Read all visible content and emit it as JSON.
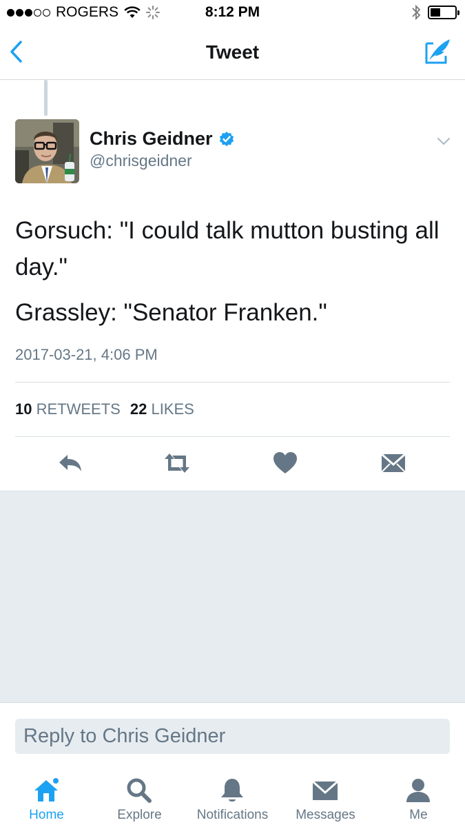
{
  "status_bar": {
    "carrier": "ROGERS",
    "time": "8:12 PM",
    "signal_bars_filled": 3,
    "signal_bars_total": 5,
    "battery_level": 0.4
  },
  "nav": {
    "title": "Tweet",
    "back_icon": "chevron-left-icon",
    "compose_icon": "compose-quill-icon"
  },
  "tweet": {
    "author_name": "Chris Geidner",
    "author_handle": "@chrisgeidner",
    "verified": true,
    "paragraphs": [
      "Gorsuch: \"I could talk mutton busting all day.\"",
      "Grassley: \"Senator Franken.\""
    ],
    "timestamp": "2017-03-21, 4:06 PM",
    "retweets_count": "10",
    "retweets_label": "RETWEETS",
    "likes_count": "22",
    "likes_label": "LIKES"
  },
  "reply": {
    "placeholder": "Reply to Chris Geidner",
    "value": ""
  },
  "tabs": [
    {
      "label": "Home",
      "icon": "home-icon",
      "active": true
    },
    {
      "label": "Explore",
      "icon": "search-icon",
      "active": false
    },
    {
      "label": "Notifications",
      "icon": "bell-icon",
      "active": false
    },
    {
      "label": "Messages",
      "icon": "envelope-icon",
      "active": false
    },
    {
      "label": "Me",
      "icon": "person-icon",
      "active": false
    }
  ],
  "colors": {
    "accent": "#1da1f2",
    "icon_gray": "#657786",
    "text": "#14171a",
    "background_gray": "#e6ecf0"
  }
}
